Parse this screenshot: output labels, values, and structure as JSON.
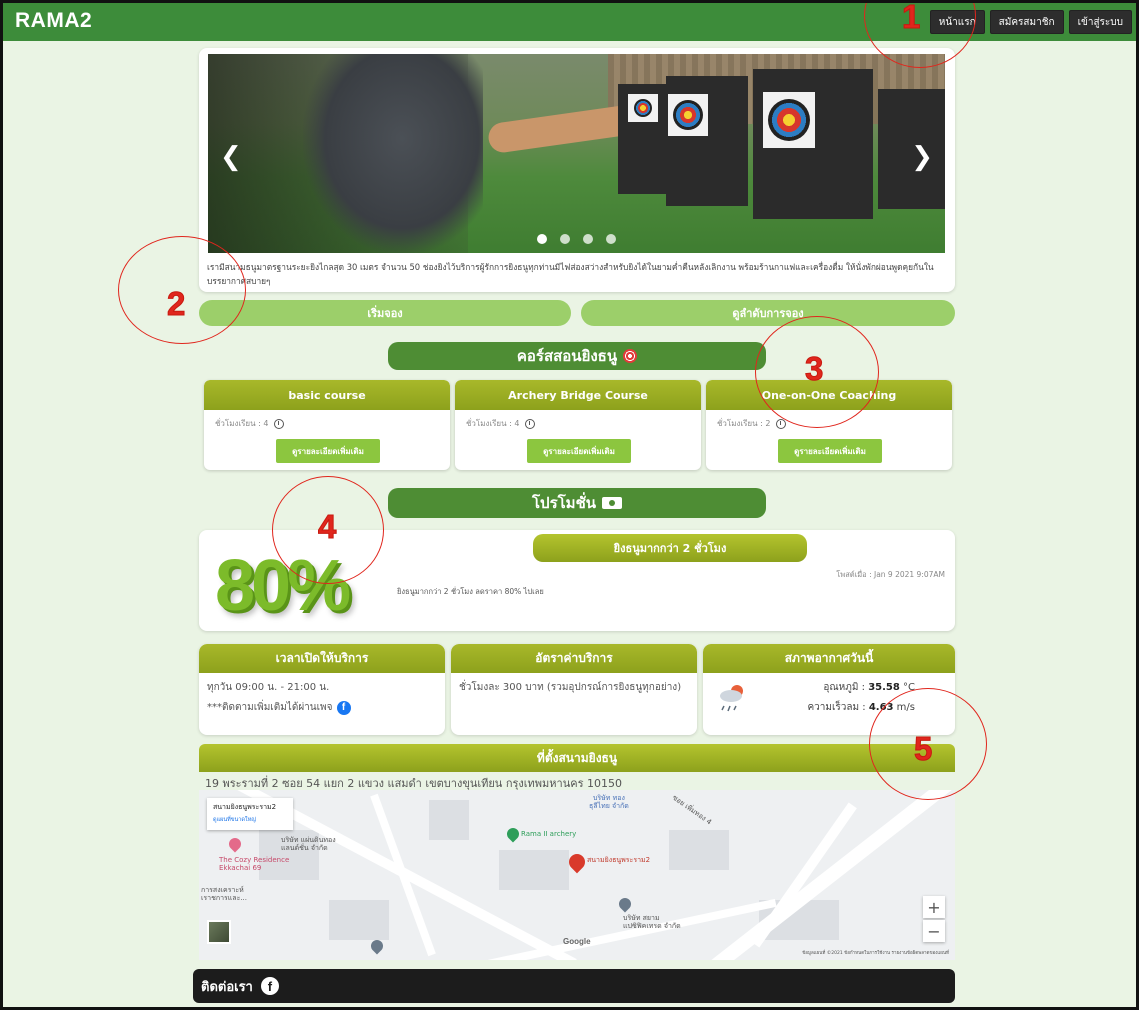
{
  "navbar": {
    "brand": "RAMA2",
    "buttons": [
      "หน้าแรก",
      "สมัครสมาชิก",
      "เข้าสู่ระบบ"
    ]
  },
  "hero": {
    "caption": "เรามีสนามธนูมาตรฐานระยะยิงไกลสุด 30 เมตร จำนวน 50 ช่องยิงไว้บริการผู้รักการยิงธนูทุกท่านมีไฟส่องสว่างสำหรับยิงได้ในยามค่ำคืนหลังเลิกงาน พร้อมร้านกาแฟและเครื่องดื่ม ให้นั่งพักผ่อนพูดคุยกันในบรรยากาศสบายๆ",
    "prev_arrow": "❮",
    "next_arrow": "❯",
    "slide_count": 4,
    "active_slide": 1
  },
  "booking": {
    "start_label": "เริ่มจอง",
    "queue_label": "ดูลำดับการจอง"
  },
  "courses": {
    "title": "คอร์สสอนยิงธนู",
    "items": [
      {
        "name": "basic course",
        "hours": "ชั่วโมงเรียน : 4",
        "button": "ดูรายละเอียดเพิ่มเติม"
      },
      {
        "name": "Archery Bridge Course",
        "hours": "ชั่วโมงเรียน : 4",
        "button": "ดูรายละเอียดเพิ่มเติม"
      },
      {
        "name": "One-on-One Coaching",
        "hours": "ชั่วโมงเรียน : 2",
        "button": "ดูรายละเอียดเพิ่มเติม"
      }
    ]
  },
  "promotion": {
    "title": "โปรโมชั่น",
    "image_text": "80%",
    "headline": "ยิงธนูมากกว่า 2 ชั่วโมง",
    "posted": "โพสต์เมื่อ : Jan 9 2021 9:07AM",
    "text": "ยิงธนูมากกว่า 2 ชั่วโมง ลดราคา 80% ไปเลย"
  },
  "info": {
    "hours": {
      "title": "เวลาเปิดให้บริการ",
      "line1": "ทุกวัน 09:00 น. - 21:00 น.",
      "line2": "***ติดตามเพิ่มเติมได้ผ่านเพจ"
    },
    "rates": {
      "title": "อัตราค่าบริการ",
      "line1": "ชั่วโมงละ 300 บาท (รวมอุปกรณ์การยิงธนูทุกอย่าง)"
    },
    "weather": {
      "title": "สภาพอากาศวันนี้",
      "temp_label": "อุณหภูมิ : ",
      "temp_value": "35.58",
      "temp_unit": " °C",
      "wind_label": "ความเร็วลม : ",
      "wind_value": "4.63",
      "wind_unit": " m/s"
    }
  },
  "location": {
    "title": "ที่ตั้งสนามยิงธนู",
    "address": "19 พระรามที่ 2 ซอย 54 แยก 2 แขวง แสมดำ เขตบางขุนเทียน กรุงเทพมหานคร 10150",
    "map": {
      "info_name": "สนามยิงธนูพระราม2",
      "info_link": "ดูแผนที่ขนาดใหญ่",
      "labels": {
        "company_top": "บริษัท ทอง\nธุลีไทย จำกัด",
        "company_left": "บริษัท แผ่นดินทอง\nแลนด์ชั่น จำกัด",
        "cozy": "The Cozy Residence\nEkkachai 69",
        "welfare": "การสงเคราะห์\nเราชการและ...",
        "rama_archery": "Rama II archery",
        "target_place": "สนามยิงธนูพระราม2",
        "company_bottom": "บริษัท สยาม\nแปซิฟิคเทรด จำกัด",
        "soi": "ซอย เพิ่มทอง 4",
        "google": "Google",
        "footer": "ข้อมูลแผนที่ ©2021   ข้อกำหนดในการใช้งาน   รายงานข้อผิดพลาดของแผนที่"
      },
      "zoom_in": "+",
      "zoom_out": "−"
    }
  },
  "footer": {
    "contact": "ติดต่อเรา"
  },
  "annotations": [
    "1",
    "2",
    "3",
    "4",
    "5"
  ],
  "colors": {
    "navbar": "#3d8c3a",
    "olive": "#9aae22",
    "light_green": "#9ccf6a",
    "annotation": "#e0261d"
  }
}
